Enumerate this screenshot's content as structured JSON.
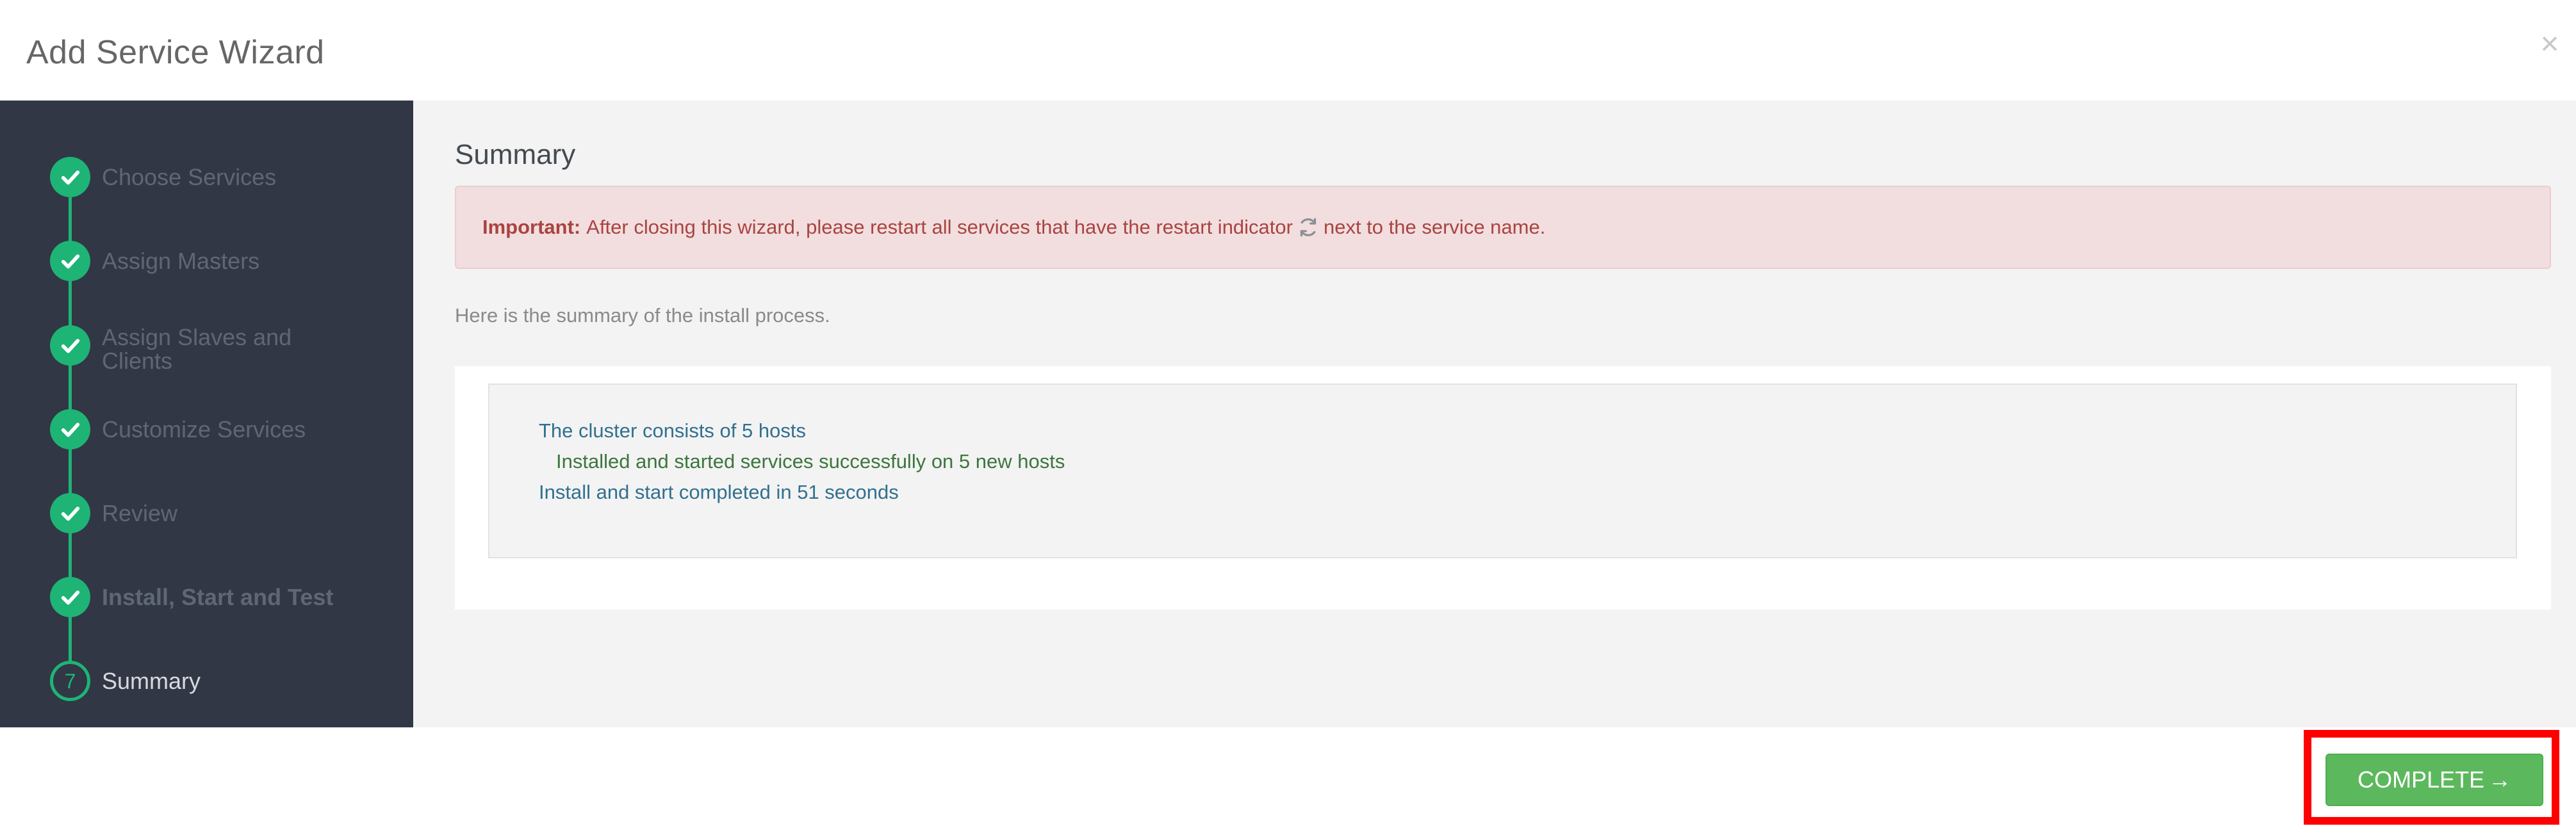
{
  "modal": {
    "title": "Add Service Wizard",
    "close_symbol": "×"
  },
  "sidebar": {
    "steps": [
      {
        "label": "Choose Services",
        "status": "completed",
        "icon": "check-icon"
      },
      {
        "label": "Assign Masters",
        "status": "completed",
        "icon": "check-icon"
      },
      {
        "label": "Assign Slaves and Clients",
        "status": "completed",
        "icon": "check-icon"
      },
      {
        "label": "Customize Services",
        "status": "completed",
        "icon": "check-icon"
      },
      {
        "label": "Review",
        "status": "completed",
        "icon": "check-icon"
      },
      {
        "label": "Install, Start and Test",
        "status": "completed",
        "icon": "check-icon"
      },
      {
        "label": "Summary",
        "status": "current",
        "number": "7"
      }
    ]
  },
  "main": {
    "title": "Summary",
    "alert": {
      "strong": "Important:",
      "text_before_icon": "After closing this wizard, please restart all services that have the restart indicator",
      "icon": "refresh-icon",
      "text_after_icon": "next to the service name."
    },
    "intro": "Here is the summary of the install process.",
    "summary_lines": [
      "The cluster consists of 5 hosts",
      "Installed and started services successfully on 5 new hosts",
      "Install and start completed in 51 seconds"
    ]
  },
  "footer": {
    "complete_button": {
      "label": "Complete",
      "arrow": "→"
    }
  },
  "colors": {
    "sidebar_bg": "#313745",
    "step_green": "#1eb475",
    "button_green": "#5cb85c",
    "alert_bg": "#f2dede",
    "alert_text": "#a94442",
    "highlight": "#ff0000"
  }
}
